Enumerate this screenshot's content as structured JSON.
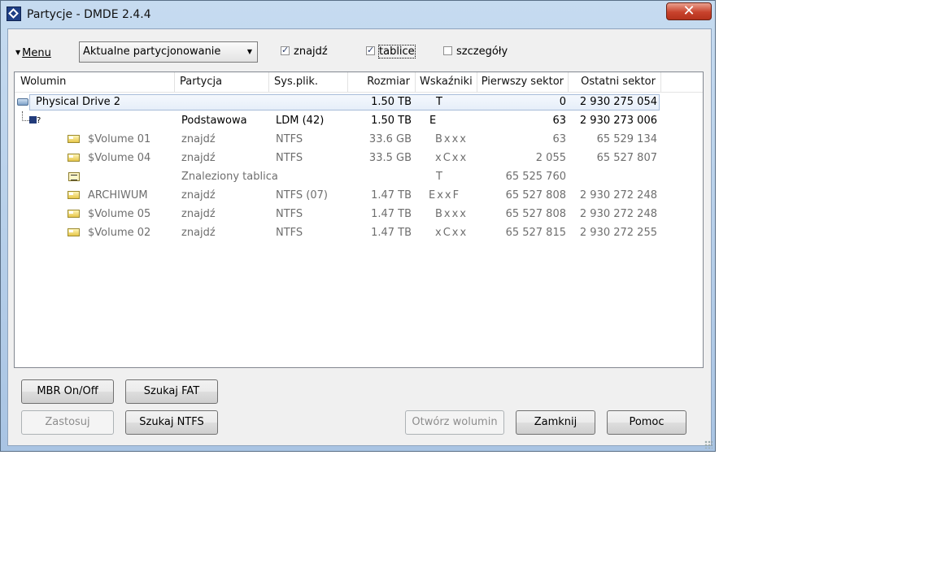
{
  "window": {
    "title": "Partycje - DMDE 2.4.4",
    "close_symbol": "✕"
  },
  "toolbar": {
    "menu_label": "Menu",
    "mode_select": "Aktualne partycjonowanie",
    "checkboxes": [
      {
        "label": "znajdź",
        "checked": true
      },
      {
        "label": "tablice",
        "checked": true
      },
      {
        "label": "szczegóły",
        "checked": false
      }
    ]
  },
  "table": {
    "columns": [
      "Wolumin",
      "Partycja",
      "Sys.plik.",
      "Rozmiar",
      "Wskaźniki",
      "Pierwszy sektor",
      "Ostatni sektor"
    ],
    "rows": [
      {
        "icon": "drive-icon",
        "volume": "Physical Drive 2",
        "partition": "",
        "fs": "",
        "size": "1.50 TB",
        "flags": "T",
        "first": "0",
        "last": "2 930 275 054",
        "style": "selected"
      },
      {
        "icon": "partition-icon",
        "volume": "",
        "partition": "Podstawowa",
        "fs": "LDM (42)",
        "size": "1.50 TB",
        "flags": "E",
        "first": "63",
        "last": "2 930 273 006",
        "style": "normal"
      },
      {
        "icon": "volume-icon",
        "volume": "$Volume 01",
        "partition": "znajdź",
        "fs": "NTFS",
        "size": "33.6 GB",
        "flags": "Bxxx",
        "first": "63",
        "last": "65 529 134",
        "style": "gray"
      },
      {
        "icon": "volume-icon",
        "volume": "$Volume 04",
        "partition": "znajdź",
        "fs": "NTFS",
        "size": "33.5 GB",
        "flags": "xCxx",
        "first": "2 055",
        "last": "65 527 807",
        "style": "gray"
      },
      {
        "icon": "table-icon",
        "volume": "",
        "partition": "Znaleziony tablica",
        "fs": "",
        "size": "",
        "flags": "T",
        "first": "65 525 760",
        "last": "",
        "style": "gray"
      },
      {
        "icon": "volume-icon",
        "volume": "ARCHIWUM",
        "partition": "znajdź",
        "fs": "NTFS (07)",
        "size": "1.47 TB",
        "flags": "ExxF",
        "first": "65 527 808",
        "last": "2 930 272 248",
        "style": "gray"
      },
      {
        "icon": "volume-icon",
        "volume": "$Volume 05",
        "partition": "znajdź",
        "fs": "NTFS",
        "size": "1.47 TB",
        "flags": "Bxxx",
        "first": "65 527 808",
        "last": "2 930 272 248",
        "style": "gray"
      },
      {
        "icon": "volume-icon",
        "volume": "$Volume 02",
        "partition": "znajdź",
        "fs": "NTFS",
        "size": "1.47 TB",
        "flags": "xCxx",
        "first": "65 527 815",
        "last": "2 930 272 255",
        "style": "gray"
      }
    ]
  },
  "buttons": {
    "mbr": "MBR On/Off",
    "fat": "Szukaj FAT",
    "apply": "Zastosuj",
    "ntfs": "Szukaj NTFS",
    "open": "Otwórz wolumin",
    "close": "Zamknij",
    "help": "Pomoc"
  }
}
